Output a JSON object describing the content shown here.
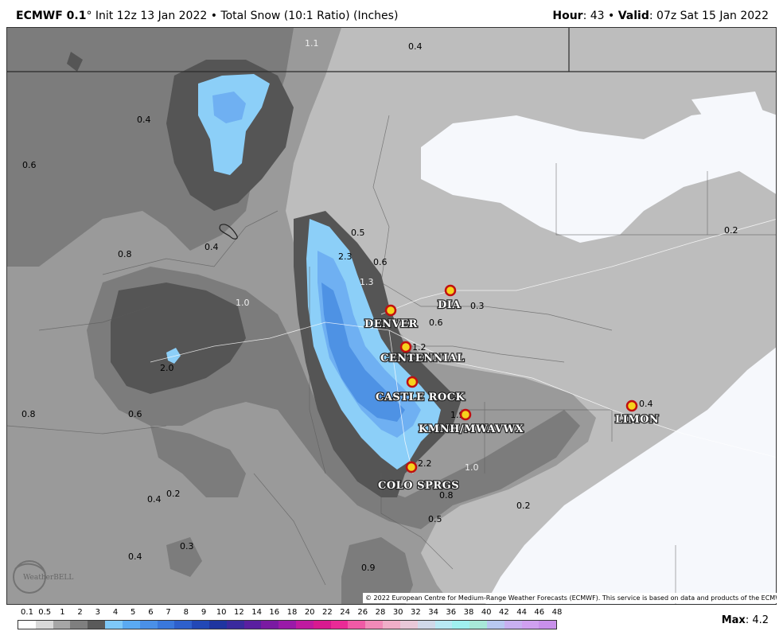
{
  "header": {
    "model": "ECMWF 0.1",
    "degree": "°",
    "init": " Init 12z 13 Jan 2022 • Total Snow (10:1 Ratio) (Inches)",
    "hour_label": "Hour",
    "hour_value": ": 43 • ",
    "valid_label": "Valid",
    "valid_value": ": 07z Sat 15 Jan 2022"
  },
  "cities": [
    {
      "name": "DIA"
    },
    {
      "name": "DENVER"
    },
    {
      "name": "CENTENNIAL"
    },
    {
      "name": "CASTLE ROCK"
    },
    {
      "name": "KMNH/MWAVWX"
    },
    {
      "name": "LIMON"
    },
    {
      "name": "COLO SPRGS"
    }
  ],
  "values": [
    "1.1",
    "0.4",
    "0.4",
    "0.6",
    "0.4",
    "0.8",
    "0.5",
    "2.3",
    "0.6",
    "1.3",
    "1.0",
    "0.3",
    "0.6",
    "1.2",
    "2.0",
    "0.8",
    "0.6",
    "1.9",
    "0.4",
    "0.2",
    "2.2",
    "1.0",
    "0.8",
    "0.2",
    "0.4",
    "0.2",
    "0.5",
    "0.3",
    "0.4",
    "0.9"
  ],
  "credit": "© 2022 European Centre for Medium-Range Weather Forecasts (ECMWF). This service is based on data and products of the ECMWF.",
  "logo": "WeatherBELL",
  "legend": {
    "labels": [
      "0.1",
      "0.5",
      "1",
      "2",
      "3",
      "4",
      "5",
      "6",
      "7",
      "8",
      "9",
      "10",
      "12",
      "14",
      "16",
      "18",
      "20",
      "22",
      "24",
      "26",
      "28",
      "30",
      "32",
      "34",
      "36",
      "38",
      "40",
      "42",
      "44",
      "46",
      "48"
    ],
    "colors": [
      "#ffffff",
      "#d9d9d9",
      "#a6a6a6",
      "#7f7f7f",
      "#5a5a5a",
      "#7ec8f8",
      "#5aaaf2",
      "#4a90e8",
      "#3a78dc",
      "#2e60cc",
      "#2248b6",
      "#1f35a0",
      "#3a2a9e",
      "#5a1fa0",
      "#7a1aa2",
      "#9a1aa8",
      "#c01aa0",
      "#d81a90",
      "#ea2a96",
      "#f05aa6",
      "#f18ab8",
      "#f0aec8",
      "#e8c8d8",
      "#d0d8e8",
      "#b8e8f4",
      "#a0f0f0",
      "#a8e8d8",
      "#b8c8f0",
      "#c8b0f0",
      "#d0a0f0",
      "#c890ea"
    ]
  },
  "max": {
    "label": "Max",
    "value": ": 4.2"
  }
}
